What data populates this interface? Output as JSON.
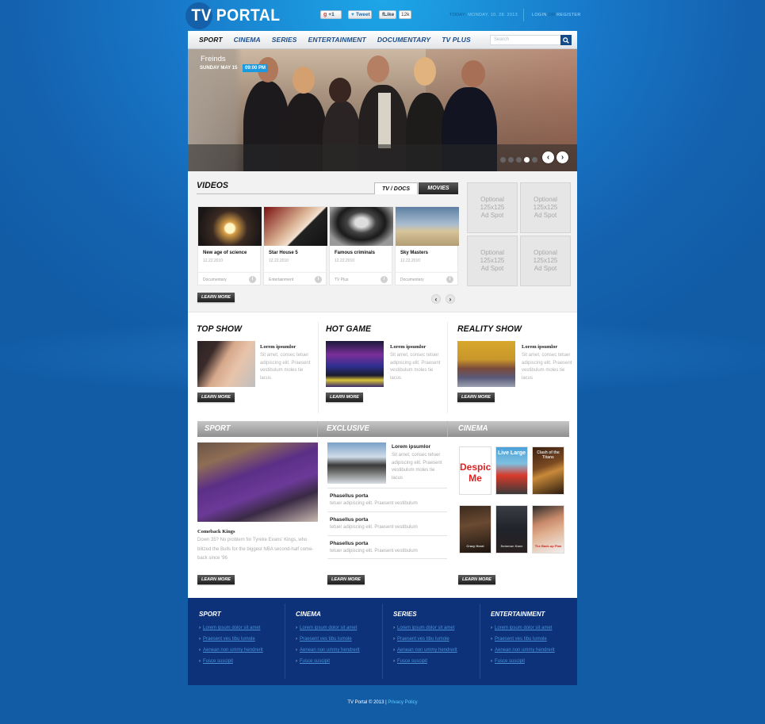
{
  "header": {
    "logo": "TV PORTAL",
    "social": {
      "gplus": "+1",
      "tweet": "Tweet",
      "like": "Like",
      "like_count": "12k"
    },
    "today_label": "TODAY:",
    "today_value": "MONDAY, 10. 28. 2013",
    "login": "LOGIN",
    "or": "OR",
    "register": "REGISTER"
  },
  "nav": {
    "items": [
      "SPORT",
      "CINEMA",
      "SERIES",
      "ENTERTAINMENT",
      "DOCUMENTARY",
      "TV PLUS"
    ],
    "search_placeholder": "Search",
    "search_icon": "magnifier-icon"
  },
  "slider": {
    "title": "Freinds",
    "day": "SUNDAY   MAY 15",
    "time": "09:00 PM",
    "dots_total": 5,
    "active_dot": 4,
    "prev": "‹",
    "next": "›"
  },
  "videos": {
    "title": "VIDEOS",
    "tabs": [
      "TV / DOCS",
      "MOVIES"
    ],
    "active_tab": "TV / DOCS",
    "items": [
      {
        "title": "New age of science",
        "date": "12.22.2010",
        "category": "Documentary"
      },
      {
        "title": "Star House 5",
        "date": "12.22.2010",
        "category": "Entertainment"
      },
      {
        "title": "Famous criminals",
        "date": "12.22.2010",
        "category": "TV Plus"
      },
      {
        "title": "Sky Masters",
        "date": "12.22.2010",
        "category": "Documentary"
      }
    ],
    "learn_more": "LEARN MORE",
    "prev": "‹",
    "next": "›"
  },
  "ads": [
    "Optional 125x125 Ad Spot",
    "Optional 125x125 Ad Spot",
    "Optional 125x125 Ad Spot",
    "Optional 125x125 Ad Spot"
  ],
  "shows": [
    {
      "heading": "TOP SHOW",
      "title": "Lorem ipsumlor",
      "text": "Sit amet, consec tetuer adipiscing elit. Praesent vestibulum moles tie lacus",
      "learn_more": "LEARN MORE"
    },
    {
      "heading": "HOT GAME",
      "title": "Lorem ipsumlor",
      "text": "Sit amet, consec tetuer adipiscing elit. Praesent vestibulum moles tie lacus",
      "learn_more": "LEARN MORE"
    },
    {
      "heading": "REALITY SHOW",
      "title": "Lorem ipsumlor",
      "text": "Sit amet, consec tetuer adipiscing elit. Praesent vestibulum moles tie lacus",
      "learn_more": "LEARN MORE"
    }
  ],
  "categories": {
    "sport": {
      "heading": "SPORT",
      "title": "Comeback Kings",
      "text": "Down 35? No problem for Tyreke Evans' Kings, who blitzed the Bulls for the biggest NBA second-half come-back since '96",
      "learn_more": "LEARN MORE"
    },
    "exclusive": {
      "heading": "EXCLUSIVE",
      "title": "Lorem ipsumlor",
      "text": "Sit amet, consec tetuer adipiscing elit. Praesent vestibulum moles tie lacus",
      "items": [
        {
          "title": "Phasellus porta",
          "text": "tetuer adipiscing elit. Praesent vestibulum"
        },
        {
          "title": "Phasellus porta",
          "text": "tetuer adipiscing elit. Praesent vestibulum"
        },
        {
          "title": "Phasellus porta",
          "text": "tetuer adipiscing elit. Praesent vestibulum"
        }
      ],
      "learn_more": "LEARN MORE"
    },
    "cinema": {
      "heading": "CINEMA",
      "posters": [
        "Despicable Me",
        "Live Large",
        "Clash of the Titans",
        "Crazy Heart",
        "Solomon Kane",
        "The Back-up Plan"
      ],
      "learn_more": "LEARN MORE"
    }
  },
  "footer": {
    "columns": [
      {
        "title": "SPORT",
        "links": [
          "Lorem ipsum dolor sit amet",
          "Praesent ves tibu lumole",
          "Aenean non ummy hendrerit",
          "Fusce suscipit"
        ]
      },
      {
        "title": "CINEMA",
        "links": [
          "Lorem ipsum dolor sit amet",
          "Praesent ves tibu lumole",
          "Aenean non ummy hendrerit",
          "Fusce suscipit"
        ]
      },
      {
        "title": "SERIES",
        "links": [
          "Lorem ipsum dolor sit amet",
          "Praesent ves tibu lumole",
          "Aenean non ummy hendrerit",
          "Fusce suscipit"
        ]
      },
      {
        "title": "ENTERTAINMENT",
        "links": [
          "Lorem ipsum dolor sit amet",
          "Praesent ves tibu lumole",
          "Aenean non ummy hendrerit",
          "Fusce suscipit"
        ]
      }
    ],
    "copyright": "TV Portal © 2013 | ",
    "privacy": "Privacy Policy"
  },
  "colors": {
    "brand_blue": "#1877c8",
    "nav_text": "#1a4d8c",
    "accent_time": "#1b9ae0",
    "footer_bg": "#0d3279",
    "footer_link": "#4a90d6"
  }
}
